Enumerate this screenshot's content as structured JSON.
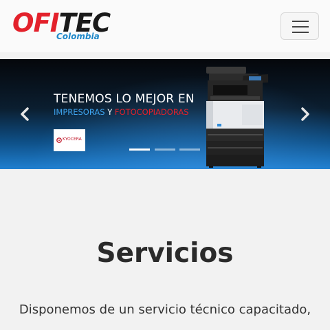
{
  "header": {
    "logo": {
      "main_left": "OFI",
      "main_right": "TEC",
      "sub": "Colombia"
    },
    "menu_icon": "hamburger-icon"
  },
  "carousel": {
    "title": "TENEMOS LO MEJOR EN",
    "subtitle_part1": "IMPRESORAS",
    "subtitle_and": " Y ",
    "subtitle_part2": "FOTOCOPIADORAS",
    "brand": "KYOCERA",
    "prev_icon": "chevron-left-icon",
    "next_icon": "chevron-right-icon",
    "slides_count": 3,
    "active_slide": 1
  },
  "services": {
    "title": "Servicios",
    "text": "Disponemos de un servicio técnico capacitado,",
    "text_cont": "..."
  },
  "colors": {
    "brand_red": "#e3212b",
    "brand_blue": "#1f88c9",
    "subtitle_blue": "#3ea4f0"
  }
}
